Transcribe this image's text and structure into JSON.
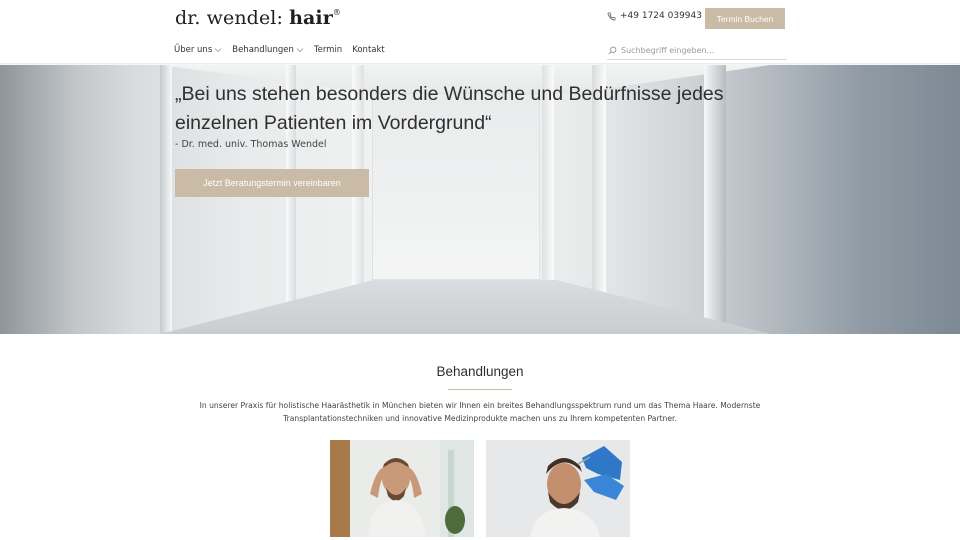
{
  "header": {
    "logo": {
      "light": "dr. wendel: ",
      "strong": "hair",
      "mark": "®"
    },
    "phone": "+49 1724 039943",
    "book_button": "Termin Buchen",
    "nav": [
      {
        "label": "Über uns",
        "has_dropdown": true
      },
      {
        "label": "Behandlungen",
        "has_dropdown": true
      },
      {
        "label": "Termin",
        "has_dropdown": false
      },
      {
        "label": "Kontakt",
        "has_dropdown": false
      }
    ],
    "search": {
      "placeholder": "Suchbegriff eingeben...",
      "value": ""
    }
  },
  "hero": {
    "quote": "„Bei uns stehen besonders die Wünsche und Bedürfnisse jedes einzelnen Patienten im Vordergrund“",
    "author": "- Dr. med. univ. Thomas Wendel",
    "cta": "Jetzt Beratungstermin vereinbaren"
  },
  "treatments": {
    "title": "Behandlungen",
    "text": "In unserer Praxis für holistische Haarästhetik in München bieten wir Ihnen ein breites Behandlungsspektrum rund um das Thema Haare. Modernste Transplantationstechniken und innovative Medizinprodukte machen uns zu Ihrem kompetenten Partner.",
    "cards": [
      {
        "image": "man-checking-hairline-photo"
      },
      {
        "image": "scalp-injection-treatment-photo"
      }
    ]
  },
  "colors": {
    "accent": "#c9bba5",
    "text": "#2f2f2f"
  }
}
